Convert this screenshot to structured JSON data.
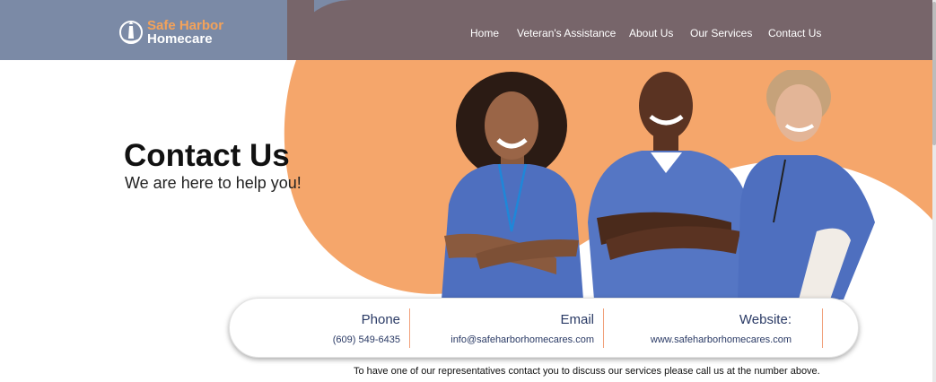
{
  "brand": {
    "line1": "Safe Harbor",
    "line2": "Homecare",
    "icon": "lighthouse-icon",
    "accent_color": "#f3a25a"
  },
  "nav": {
    "items": [
      {
        "label": "Home"
      },
      {
        "label": "Veteran's Assistance"
      },
      {
        "label": "About Us"
      },
      {
        "label": "Our Services"
      },
      {
        "label": "Contact Us"
      }
    ]
  },
  "hero": {
    "title": "Contact Us",
    "subtitle": "We are here to help you!",
    "image": "three-nurses-in-blue-scrubs-smiling"
  },
  "contact": {
    "phone": {
      "label": "Phone",
      "value": "(609) 549-6435"
    },
    "email": {
      "label": "Email",
      "value": "info@safeharborhomecares.com"
    },
    "website": {
      "label": "Website:",
      "value": "www.safeharborhomecares.com"
    }
  },
  "footer_note": "To have one of our representatives contact you to discuss our services please call us at the number above.",
  "colors": {
    "header_left": "#7b8aa6",
    "header_right": "#77656a",
    "peach": "#f5a66b",
    "text_navy": "#2a3a65"
  }
}
